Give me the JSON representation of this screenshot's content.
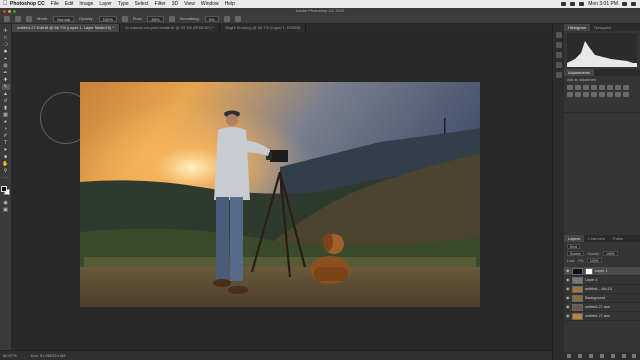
{
  "menubar": {
    "app_name": "Photoshop CC",
    "items": [
      "File",
      "Edit",
      "Image",
      "Layer",
      "Type",
      "Select",
      "Filter",
      "3D",
      "View",
      "Window",
      "Help"
    ],
    "clock": "Mon 3:01 PM"
  },
  "window": {
    "title": "Adobe Photoshop CC 2019"
  },
  "options_bar": {
    "mode_label": "Mode:",
    "mode_value": "Normal",
    "opacity_label": "Opacity:",
    "opacity_value": "100%",
    "flow_label": "Flow:",
    "flow_value": "80%",
    "smoothing_label": "Smoothing:",
    "smoothing_value": "0%"
  },
  "document_tabs": [
    {
      "label": "untitled-27-Edit.tif @ 66.7% (Layer 1, Layer Mask/16) *"
    },
    {
      "label": "3c-tutorial-xxx-peel-matte.tif @ 33.3% (RGB/16*) *"
    },
    {
      "label": "Bright Sunning @ 66.7% (Layer 1, RGB/8)"
    }
  ],
  "status_bar": {
    "zoom": "66.67%",
    "doc_info": "Doc: 51.9M/244.6M"
  },
  "panels": {
    "histogram_tabs": [
      "Histogram",
      "Navigator"
    ],
    "adjustments_tab": "Adjustments",
    "adjustments_hint": "Add an adjustment",
    "layers_tabs": [
      "Layers",
      "Channels",
      "Paths"
    ],
    "kind_label": "Kind",
    "blend_mode": "Screen",
    "opacity_label": "Opacity:",
    "opacity_value": "100%",
    "lock_label": "Lock:",
    "fill_label": "Fill:",
    "fill_value": "100%"
  },
  "layers": [
    {
      "name": "Layer 1",
      "has_mask": true
    },
    {
      "name": "Layer 1",
      "has_mask": false
    },
    {
      "name": "untitled-...Nd-10",
      "has_mask": false
    },
    {
      "name": "Background",
      "has_mask": false
    },
    {
      "name": "untitled-27.arw",
      "has_mask": false
    },
    {
      "name": "untitled-27.arw",
      "has_mask": false
    }
  ],
  "colors": {
    "chrome_dark": "#1e1e1e",
    "panel": "#353535",
    "sky_top": "#3a4a66",
    "sunset": "#f0a040",
    "hill": "#2a3a2a"
  }
}
